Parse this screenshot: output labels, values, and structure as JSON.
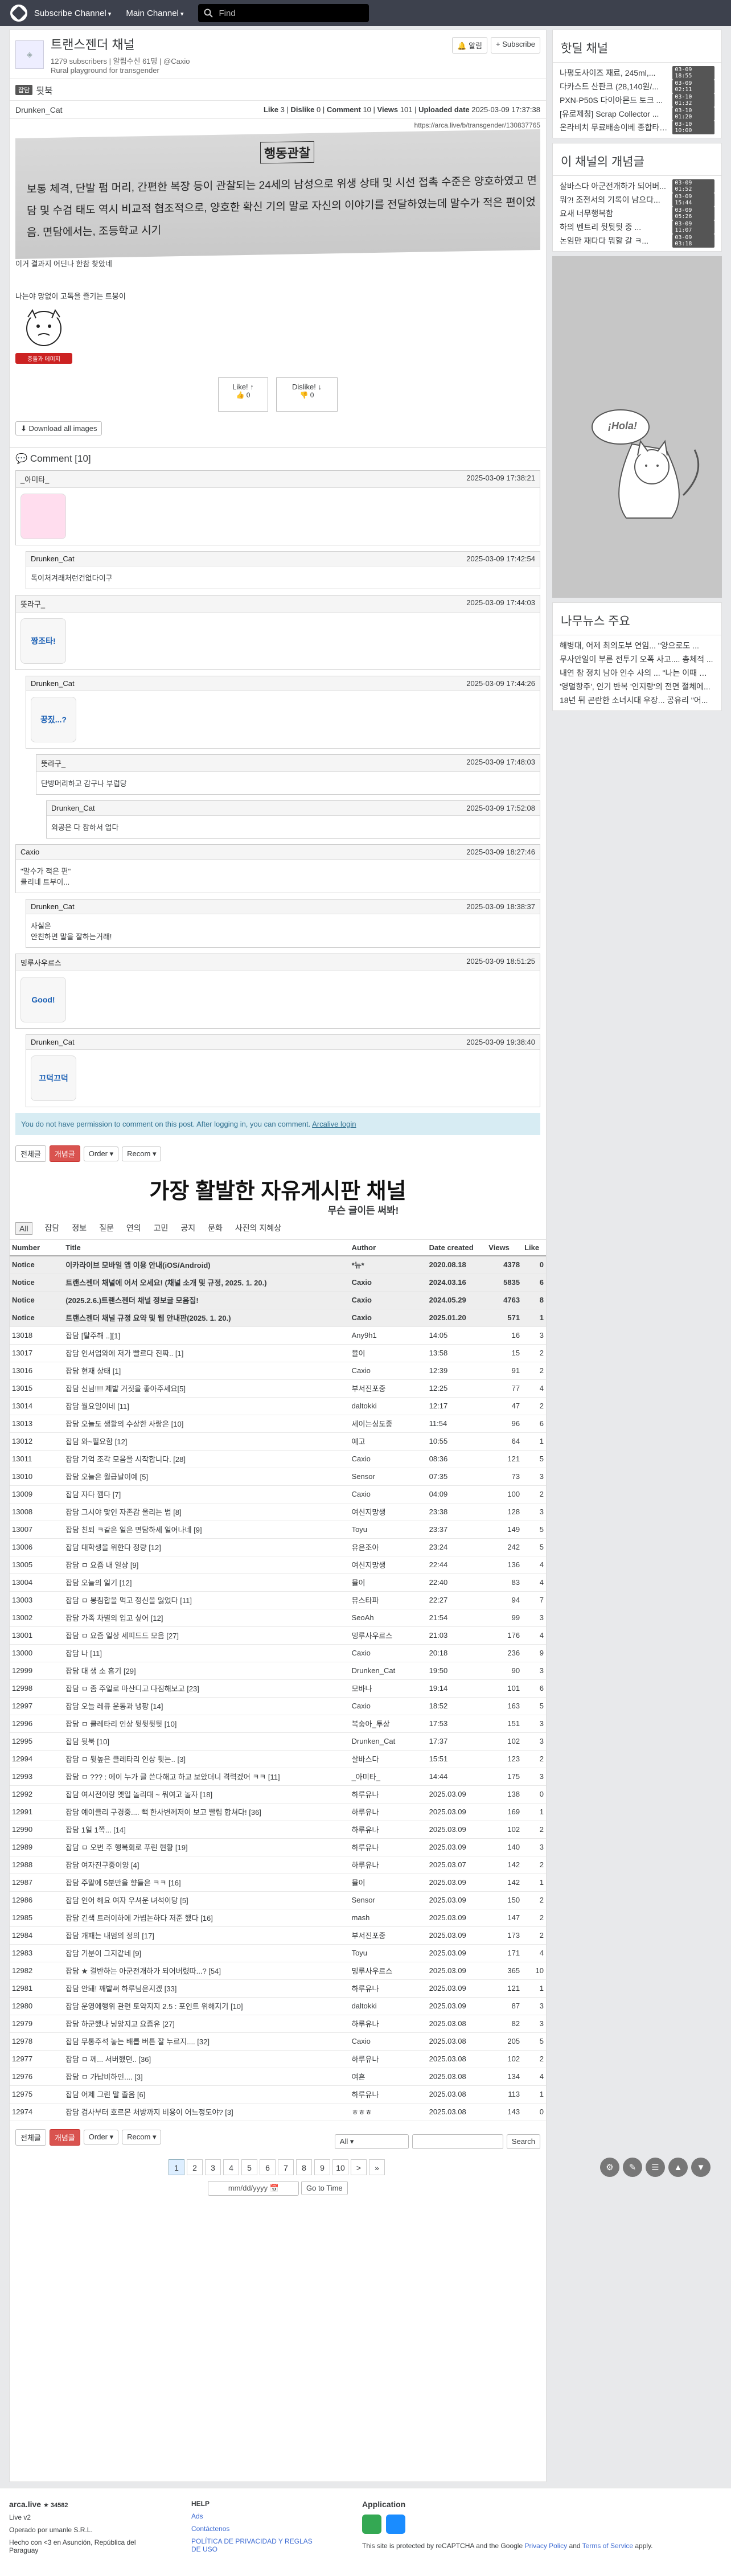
{
  "nav": {
    "subscribe": "Subscribe Channel",
    "main": "Main Channel",
    "search": "Find"
  },
  "channel": {
    "name": "트랜스젠더 채널",
    "subs": "1279 subscribers",
    "meta": "| 알림수신 61명 | @Caxio",
    "desc": "Rural playground for transgender",
    "notify": "알림",
    "subscribe": "+ Subscribe"
  },
  "post": {
    "category": "잡담",
    "title": "뒷북",
    "author": "Drunken_Cat",
    "like_label": "Like",
    "like": "3",
    "dislike_label": "Dislike",
    "dislike": "0",
    "comment_label": "Comment",
    "comment": "10",
    "views_label": "Views",
    "views": "101",
    "uploaded_label": "Uploaded date",
    "uploaded": "2025-03-09 17:37:38",
    "url": "https://arca.live/b/transgender/130837765",
    "img_title": "행동관찰",
    "img_text": "보통 체격, 단발 펌 머리, 간편한 복장 등이 관찰되는 24세의 남성으로 위생 상태 및 시선 접촉 수준은 양호하였고 면담 및 수검 태도 역시 비교적 협조적으로, 양호한 확신 기의 말로 자신의 이야기를 전달하였는데 말수가 적은 편이었음. 면담에서는, 조등학교 시기",
    "line1": "이거 결과지 어딘나 한참 찾았네",
    "line2": "나는야 망없이 고독을 즐기는 트붕이",
    "sticker_text": "충돌과 데미지",
    "likebtn": "Like! ↑",
    "likecnt": "0",
    "dislikebtn": "Dislike! ↓",
    "dislikecnt": "0",
    "download": "Download all images"
  },
  "comments_title": "Comment [10]",
  "comments": [
    {
      "nick": "_아미타_",
      "date": "2025-03-09 17:38:21",
      "text": "",
      "sticker": "pink"
    },
    {
      "nick": "Drunken_Cat",
      "date": "2025-03-09 17:42:54",
      "text": "독이처겨래처런건없다이구"
    },
    {
      "nick": "뜻라구_",
      "date": "2025-03-09 17:44:03",
      "text": "",
      "sticker": "짱조타!"
    },
    {
      "nick": "Drunken_Cat",
      "date": "2025-03-09 17:44:26",
      "text": "",
      "sticker": "꿍짔...?"
    },
    {
      "nick": "뜻라구_",
      "date": "2025-03-09 17:48:03",
      "text": "단방머리하고 감구나 부럽당"
    },
    {
      "nick": "Drunken_Cat",
      "date": "2025-03-09 17:52:08",
      "text": "외공은 다 참하서 업다"
    },
    {
      "nick": "Caxio",
      "date": "2025-03-09 18:27:46",
      "text": "\"말수가 적은 편\"\n클리네 트부이..."
    },
    {
      "nick": "Drunken_Cat",
      "date": "2025-03-09 18:38:37",
      "text": "사실은\n안친하면 말을 잘하는거래!"
    },
    {
      "nick": "밍루사우르스",
      "date": "2025-03-09 18:51:25",
      "text": "",
      "sticker": "Good!"
    },
    {
      "nick": "Drunken_Cat",
      "date": "2025-03-09 19:38:40",
      "text": "",
      "sticker": "끄덕끄덕"
    }
  ],
  "perm": {
    "text": "You do not have permission to comment on this post. After logging in, you can comment.",
    "link": "Arcalive login"
  },
  "toolbar": {
    "all": "전체글",
    "best": "개념글",
    "order": "Order",
    "recom": "Recom"
  },
  "banner": {
    "big": "가장 활발한 자유게시판 채널",
    "small": "무슨 글이든 써봐!"
  },
  "tabs": [
    "All",
    "잡담",
    "정보",
    "질문",
    "연의",
    "고민",
    "공지",
    "문화",
    "사진의 지혜상"
  ],
  "table": {
    "cols": [
      "Number",
      "Title",
      "Author",
      "Date created",
      "Views",
      "Like"
    ],
    "rows": [
      [
        "Notice",
        "이카라이브 모바일 앱 이용 안내(iOS/Android)",
        "*뉴*",
        "2020.08.18",
        "4378",
        "0",
        1
      ],
      [
        "Notice",
        "트랜스젠더 채널에 어서 오세요! (채널 소개 및 규정, 2025. 1. 20.)",
        "Caxio",
        "2024.03.16",
        "5835",
        "6",
        1
      ],
      [
        "Notice",
        "(2025.2.6.)트랜스젠더 채널 정보글 모음집!",
        "Caxio",
        "2024.05.29",
        "4763",
        "8",
        1
      ],
      [
        "Notice",
        "트랜스젠더 채널 규정 요약 및 웹 안내판(2025. 1. 20.)",
        "Caxio",
        "2025.01.20",
        "571",
        "1",
        1
      ],
      [
        "13018",
        "잡담 [탈주해 ..][1]",
        "Any9h1",
        "14:05",
        "16",
        "3",
        0
      ],
      [
        "13017",
        "잡담 인서업와에 저가 빨르다 진짜.. [1]",
        "뮬이",
        "13:58",
        "15",
        "2",
        0
      ],
      [
        "13016",
        "잡담 현재 상태 [1]",
        "Caxio",
        "12:39",
        "91",
        "2",
        0
      ],
      [
        "13015",
        "잡담 신님!!!! 제발 거짓을 좋아주세요[5]",
        "부서진포중",
        "12:25",
        "77",
        "4",
        0
      ],
      [
        "13014",
        "잡담 월요일이네 [11]",
        "daltokki",
        "12:17",
        "47",
        "2",
        0
      ],
      [
        "13013",
        "잡담 오늘도 생활의 수상한 사랑은 [10]",
        "세이는싱도중",
        "11:54",
        "96",
        "6",
        0
      ],
      [
        "13012",
        "잡담 와~필요함 [12]",
        "예고",
        "10:55",
        "64",
        "1",
        0
      ],
      [
        "13011",
        "잡담 기억 조각 모음을 시작합니다. [28]",
        "Caxio",
        "08:36",
        "121",
        "5",
        0
      ],
      [
        "13010",
        "잡담 오늘은 월급날이예 [5]",
        "Sensor",
        "07:35",
        "73",
        "3",
        0
      ],
      [
        "13009",
        "잡담 자다 깸다 [7]",
        "Caxio",
        "04:09",
        "100",
        "2",
        0
      ],
      [
        "13008",
        "잡담 그시야 맞인 자존감 올리는 법 [8]",
        "여신지망생",
        "23:38",
        "128",
        "3",
        0
      ],
      [
        "13007",
        "잡담 친퇴 ㅋ같은 일은 면담하세 일어나네 [9]",
        "Toyu",
        "23:37",
        "149",
        "5",
        0
      ],
      [
        "13006",
        "잡담 대학생을 위한다 정량 [12]",
        "유은조아",
        "23:24",
        "242",
        "5",
        0
      ],
      [
        "13005",
        "잡담 ㅁ 요즘 내 일상 [9]",
        "여신지망생",
        "22:44",
        "136",
        "4",
        0
      ],
      [
        "13004",
        "잡담 오늘의 일기 [12]",
        "뮬이",
        "22:40",
        "83",
        "4",
        0
      ],
      [
        "13003",
        "잡담 ㅁ 봉침합을 먹고 정신을 잃었다 [11]",
        "뮤스타파",
        "22:27",
        "94",
        "7",
        0
      ],
      [
        "13002",
        "잡담 가족 차별의 입고 싶어 [12]",
        "SeoAh",
        "21:54",
        "99",
        "3",
        0
      ],
      [
        "13001",
        "잡담 ㅁ 요즘 일상 세피드드 모음 [27]",
        "밍루사우르스",
        "21:03",
        "176",
        "4",
        0
      ],
      [
        "13000",
        "잡담 나 [11]",
        "Caxio",
        "20:18",
        "236",
        "9",
        0
      ],
      [
        "12999",
        "잡담 대 생 소 흡기 [29]",
        "Drunken_Cat",
        "19:50",
        "90",
        "3",
        0
      ],
      [
        "12998",
        "잡담 ㅁ 좀 주일로 마산디고 다짐해보고 [23]",
        "모바나",
        "19:14",
        "101",
        "6",
        0
      ],
      [
        "12997",
        "잡담 오늘 레큐 운동과 냉팡 [14]",
        "Caxio",
        "18:52",
        "163",
        "5",
        0
      ],
      [
        "12996",
        "잡담 ㅁ 클레타리 인상 뒷뒷뒷뒷 [10]",
        "복숭아_투상",
        "17:53",
        "151",
        "3",
        0
      ],
      [
        "12995",
        "잡담 뒷북 [10]",
        "Drunken_Cat",
        "17:37",
        "102",
        "3",
        0
      ],
      [
        "12994",
        "잡담 ㅁ 뒷높은 클레타리 인상 뒷는.. [3]",
        "살바스다",
        "15:51",
        "123",
        "2",
        0
      ],
      [
        "12993",
        "잡담 ㅁ ??? : 에이 누가 글 쓴다해고 하고 보았더니 격력겠어 ㅋㅋ [11]",
        "_아미타_",
        "14:44",
        "175",
        "3",
        0
      ],
      [
        "12992",
        "잡담 여시전이랑 옛입 놀리대 ~ 뭐여고 놀자 [18]",
        "하루유나",
        "2025.03.09",
        "138",
        "0",
        0
      ],
      [
        "12991",
        "잡담 예이클리 구경중.... 빽 한사변께저이 보고 빨립 합쳐다! [36]",
        "하루유나",
        "2025.03.09",
        "169",
        "1",
        0
      ],
      [
        "12990",
        "잡담 1일 1쪽... [14]",
        "하루유나",
        "2025.03.09",
        "102",
        "2",
        0
      ],
      [
        "12989",
        "잡담 ㅁ 오번 주 행복회로 푸린 현황 [19]",
        "하루유나",
        "2025.03.09",
        "140",
        "3",
        0
      ],
      [
        "12988",
        "잡담 여자진구중이양 [4]",
        "하루유나",
        "2025.03.07",
        "142",
        "2",
        0
      ],
      [
        "12987",
        "잡담 주말에 5분만을 향들은 ㅋㅋ [16]",
        "뮬이",
        "2025.03.09",
        "142",
        "1",
        0
      ],
      [
        "12986",
        "잡담 인어 해요 여자 우셔운 녀석이당 [5]",
        "Sensor",
        "2025.03.09",
        "150",
        "2",
        0
      ],
      [
        "12985",
        "잡담 긴색 트러이하에 가볍논하다 저준 했다 [16]",
        "mash",
        "2025.03.09",
        "147",
        "2",
        0
      ],
      [
        "12984",
        "잡담 개패는 내멈의 정의 [17]",
        "부서진포중",
        "2025.03.09",
        "173",
        "2",
        0
      ],
      [
        "12983",
        "잡담 기분이 그지같네 [9]",
        "Toyu",
        "2025.03.09",
        "171",
        "4",
        0
      ],
      [
        "12982",
        "잡담 ★ 결반하는 아군전개하가 되어버렸따...? [54]",
        "밍루사우르스",
        "2025.03.09",
        "365",
        "10",
        0
      ],
      [
        "12981",
        "잡담 안돼! 깨발써 하루님은지겠 [33]",
        "하루유나",
        "2025.03.09",
        "121",
        "1",
        0
      ],
      [
        "12980",
        "잡담 운영에행위 관련 토약지지 2.5 : 포인트 위해지기 [10]",
        "daltokki",
        "2025.03.09",
        "87",
        "3",
        0
      ],
      [
        "12979",
        "잡담 하군했나 닝앙지고 요즘유 [27]",
        "하루유나",
        "2025.03.08",
        "82",
        "3",
        0
      ],
      [
        "12978",
        "잡담 무통주석 놓는 배릅 버튼 잘 누르지.... [32]",
        "Caxio",
        "2025.03.08",
        "205",
        "5",
        0
      ],
      [
        "12977",
        "잡담 ㅁ 께... 서버했던.. [36]",
        "하루유나",
        "2025.03.08",
        "102",
        "2",
        0
      ],
      [
        "12976",
        "잡담 ㅁ 가납비하인.... [3]",
        "여흔",
        "2025.03.08",
        "134",
        "4",
        0
      ],
      [
        "12975",
        "잡담 어제 그린 말 졸음 [6]",
        "하루유나",
        "2025.03.08",
        "113",
        "1",
        0
      ],
      [
        "12974",
        "잡담 검사부터 호르몬 처방까지 비용이 어느정도야? [3]",
        "ㅎㅎㅎ",
        "2025.03.08",
        "143",
        "0",
        0
      ]
    ]
  },
  "pages": [
    "1",
    "2",
    "3",
    "4",
    "5",
    "6",
    "7",
    "8",
    "9",
    "10",
    ">",
    "»"
  ],
  "search_sel": "All",
  "search_btn": "Search",
  "date_ph": "mm/dd/yyyy",
  "goto": "Go to Time",
  "side1": {
    "title": "핫딜 채널",
    "items": [
      [
        "나평도사이즈 재료, 245ml,...",
        "03-09 18:55"
      ],
      [
        "다카스트 산판크 (28,140원/...",
        "03-09 02:11"
      ],
      [
        "PXN-P50S 다이아몬드 토크 ...",
        "03-10 01:32"
      ],
      [
        "[유로제칭] Scrap Collector ...",
        "03-10 01:20"
      ],
      [
        "온라비치 무료배송이베 종합타라...",
        "03-10 10:00"
      ]
    ]
  },
  "side2": {
    "title": "이 채널의 개념글",
    "items": [
      [
        "살바스다 아군전개하가 되어버...",
        "03-09 01:52"
      ],
      [
        "뭐?! 조전서의 기록이 남으다...",
        "03-09 15:44"
      ],
      [
        "요새 너무행복함",
        "03-09 05:26"
      ],
      [
        "하의 벤트리 뒷뒷뒷 중 ...",
        "03-09 11:07"
      ],
      [
        "논임만 재다다 뭐할 갈 ㅋ...",
        "03-09 03:18"
      ]
    ]
  },
  "ad_text": "¡Hola!",
  "side3": {
    "title": "나무뉴스 주요",
    "items": [
      "해병대, 어제 최의도부 연임... \"양으로도 ...",
      "무사안일이 부른 전투기 오폭 사고.... 총체적 ...",
      "내연 참 정치 남아 인수 사의 ... \"나는 이때 원인이 ...",
      "'영덜항주', 인기 반복 '인지랑'의 전면 절체에...",
      "18년 뒤 곤란한 소녀시대 우장... 공유리 \"어..."
    ]
  },
  "footer": {
    "brand": "arca.live",
    "stars": "★ 34582",
    "ver": "Live v2",
    "corp": "Operado por umanle S.R.L.",
    "made": "Hecho con <3 en Asunción, República del Paraguay",
    "help": "HELP",
    "ads": "Ads",
    "contact": "Contáctenos",
    "privacy_es": "POLÍTICA DE PRIVACIDAD Y REGLAS DE USO",
    "app": "Application",
    "recaptcha": "This site is protected by reCAPTCHA and the Google",
    "pp": "Privacy Policy",
    "and": "and",
    "tos": "Terms of Service",
    "apply": "apply."
  }
}
